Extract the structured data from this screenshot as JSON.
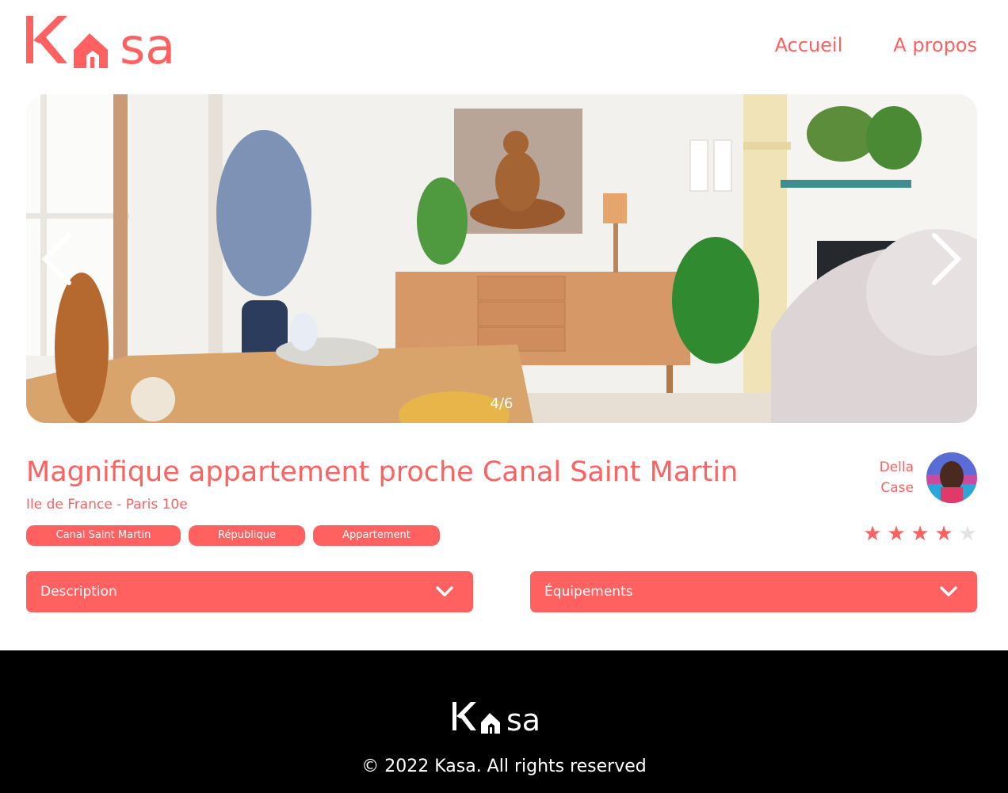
{
  "brand": {
    "name": "Kasa",
    "accent": "#FF6060"
  },
  "nav": {
    "home": "Accueil",
    "about": "A propos"
  },
  "carousel": {
    "counter": "4/6"
  },
  "listing": {
    "title": "Magnifique appartement proche Canal Saint Martin",
    "location": "Ile de France - Paris 10e",
    "tags": [
      "Canal Saint Martin",
      "République",
      "Appartement"
    ],
    "host": {
      "first_name": "Della",
      "last_name": "Case"
    },
    "rating": 4,
    "rating_max": 5
  },
  "collapses": {
    "description": "Description",
    "equipments": "Équipements"
  },
  "footer": {
    "copyright": "© 2022 Kasa. All rights reserved"
  }
}
